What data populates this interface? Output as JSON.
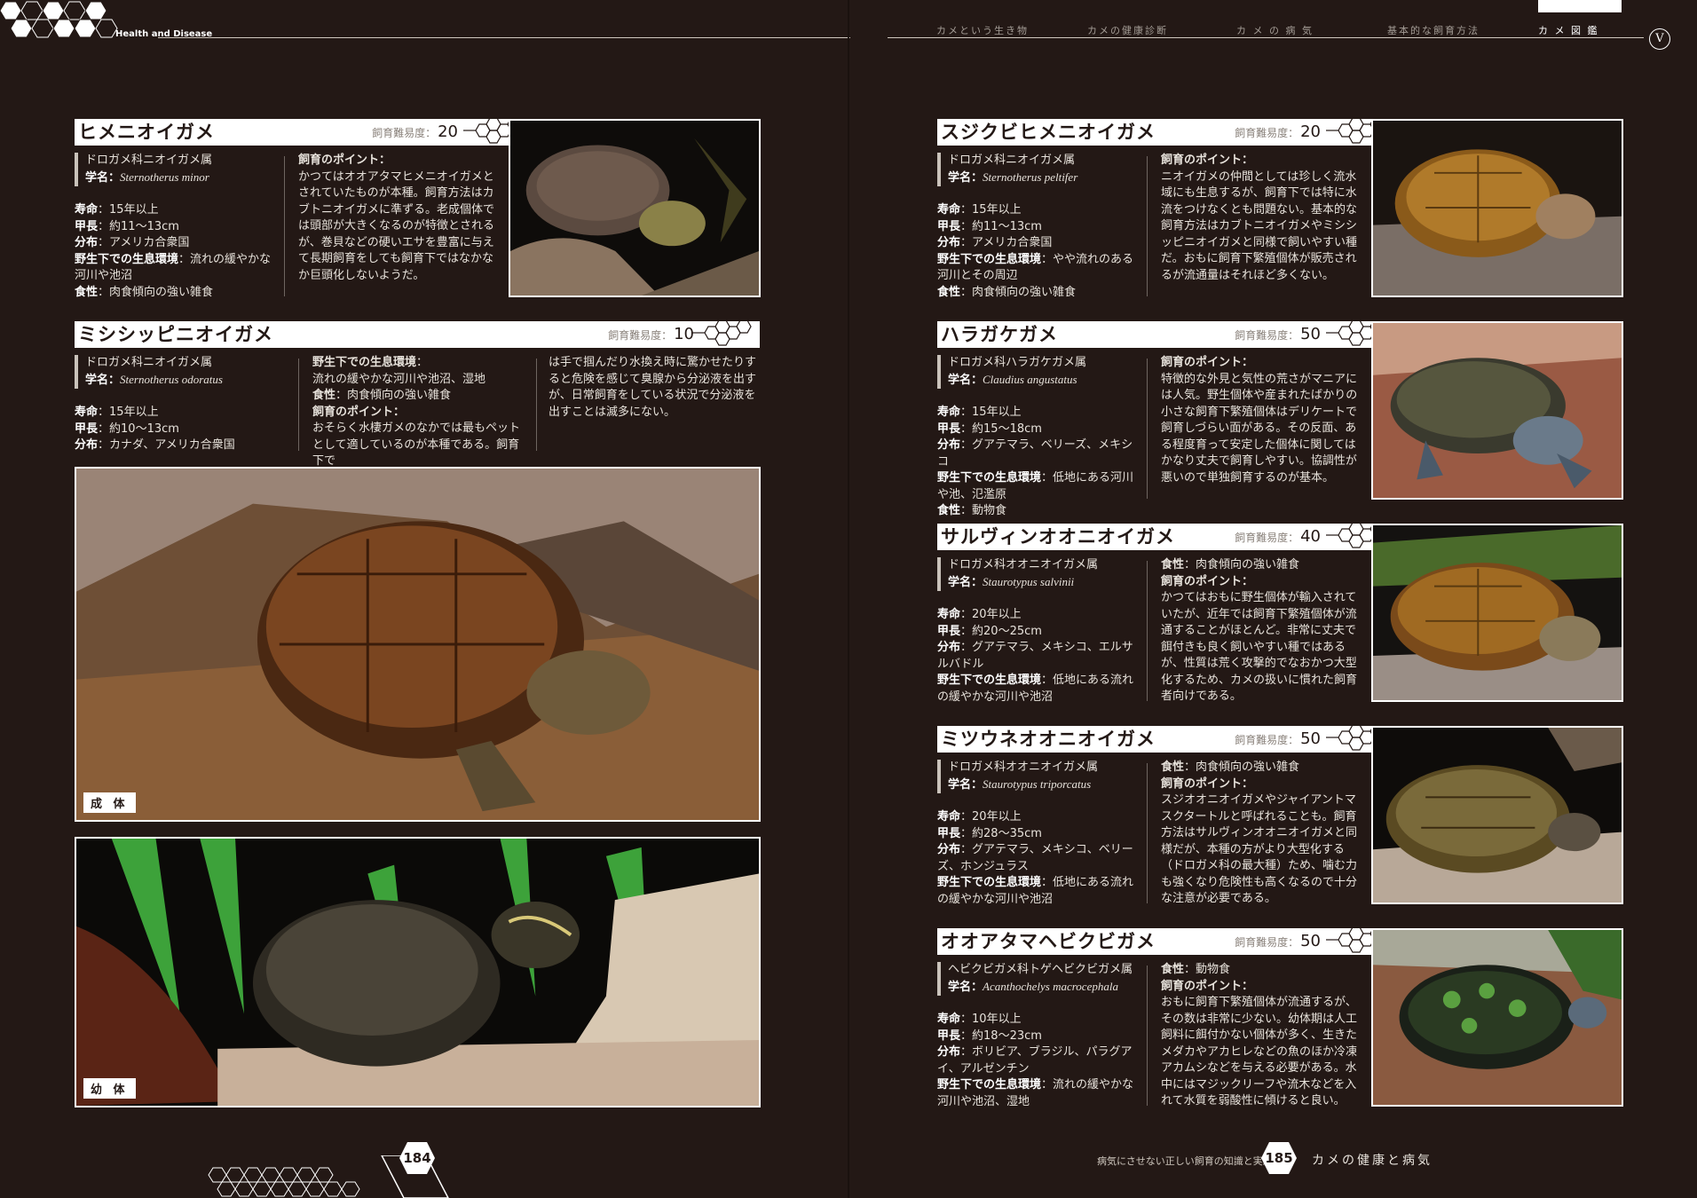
{
  "header": {
    "section_label": "Health and Disease",
    "nav": [
      "カメという生き物",
      "カメの健康診断",
      "カ メ の 病 気",
      "基本的な飼育方法",
      "カ メ 図 鑑"
    ],
    "chapter_badge": "V"
  },
  "difficulty_label": "飼育難易度：",
  "photo_tags": {
    "adult": "成 体",
    "juvenile": "幼 体"
  },
  "species": [
    {
      "name": "ヒメニオイガメ",
      "difficulty": "20",
      "family": "ドロガメ科ニオイガメ属",
      "sci_label": "学名：",
      "sci": "Sternotherus minor",
      "lifespan_label": "寿命",
      "lifespan": "15年以上",
      "length_label": "甲長",
      "length": "約11～13cm",
      "range_label": "分布",
      "range": "アメリカ合衆国",
      "habitat_label": "野生下での生息環境",
      "habitat": "流れの緩やかな河川や池沼",
      "diet_label": "食性",
      "diet": "肉食傾向の強い雑食",
      "point_label": "飼育のポイント：",
      "point": "かつてはオオアタマヒメニオイガメとされていたものが本種。飼育方法はカブトニオイガメに準ずる。老成個体では頭部が大きくなるのが特徴とされるが、巻貝などの硬いエサを豊富に与えて長期飼育をしても飼育下ではなかなか巨頭化しないようだ。"
    },
    {
      "name": "ミシシッピニオイガメ",
      "difficulty": "10",
      "family": "ドロガメ科ニオイガメ属",
      "sci_label": "学名：",
      "sci": "Sternotherus odoratus",
      "lifespan_label": "寿命",
      "lifespan": "15年以上",
      "length_label": "甲長",
      "length": "約10～13cm",
      "range_label": "分布",
      "range": "カナダ、アメリカ合衆国",
      "habitat_label": "野生下での生息環境",
      "habitat": "流れの緩やかな河川や池沼、湿地",
      "diet_label": "食性",
      "diet": "肉食傾向の強い雑食",
      "point_label": "飼育のポイント：",
      "point": "おそらく水棲ガメのなかでは最もペットとして適しているのが本種である。飼育下で",
      "point_cont": "は手で掴んだり水換え時に驚かせたりすると危険を感じて臭腺から分泌液を出すが、日常飼育をしている状況で分泌液を出すことは滅多にない。"
    },
    {
      "name": "スジクビヒメニオイガメ",
      "difficulty": "20",
      "family": "ドロガメ科ニオイガメ属",
      "sci_label": "学名：",
      "sci": "Sternotherus peltifer",
      "lifespan_label": "寿命",
      "lifespan": "15年以上",
      "length_label": "甲長",
      "length": "約11～13cm",
      "range_label": "分布",
      "range": "アメリカ合衆国",
      "habitat_label": "野生下での生息環境",
      "habitat": "やや流れのある河川とその周辺",
      "diet_label": "食性",
      "diet": "肉食傾向の強い雑食",
      "point_label": "飼育のポイント：",
      "point": "ニオイガメの仲間としては珍しく流水域にも生息するが、飼育下では特に水流をつけなくとも問題ない。基本的な飼育方法はカブトニオイガメやミシシッピニオイガメと同様で飼いやすい種だ。おもに飼育下繁殖個体が販売されるが流通量はそれほど多くない。"
    },
    {
      "name": "ハラガケガメ",
      "difficulty": "50",
      "family": "ドロガメ科ハラガケガメ属",
      "sci_label": "学名：",
      "sci": "Claudius angustatus",
      "lifespan_label": "寿命",
      "lifespan": "15年以上",
      "length_label": "甲長",
      "length": "約15～18cm",
      "range_label": "分布",
      "range": "グアテマラ、ベリーズ、メキシコ",
      "habitat_label": "野生下での生息環境",
      "habitat": "低地にある河川や池、氾濫原",
      "diet_label": "食性",
      "diet": "動物食",
      "point_label": "飼育のポイント：",
      "point": "特徴的な外見と気性の荒さがマニアには人気。野生個体や産まれたばかりの小さな飼育下繁殖個体はデリケートで飼育しづらい面がある。その反面、ある程度育って安定した個体に関してはかなり丈夫で飼育しやすい。協調性が悪いので単独飼育するのが基本。"
    },
    {
      "name": "サルヴィンオオニオイガメ",
      "difficulty": "40",
      "family": "ドロガメ科オオニオイガメ属",
      "sci_label": "学名：",
      "sci": "Staurotypus salvinii",
      "lifespan_label": "寿命",
      "lifespan": "20年以上",
      "length_label": "甲長",
      "length": "約20～25cm",
      "range_label": "分布",
      "range": "グアテマラ、メキシコ、エルサルバドル",
      "habitat_label": "野生下での生息環境",
      "habitat": "低地にある流れの緩やかな河川や池沼",
      "diet_label": "食性",
      "diet": "肉食傾向の強い雑食",
      "point_label": "飼育のポイント：",
      "point": "かつてはおもに野生個体が輸入されていたが、近年では飼育下繁殖個体が流通することがほとんど。非常に丈夫で餌付きも良く飼いやすい種ではあるが、性質は荒く攻撃的でなおかつ大型化するため、カメの扱いに慣れた飼育者向けである。"
    },
    {
      "name": "ミツウネオオニオイガメ",
      "difficulty": "50",
      "family": "ドロガメ科オオニオイガメ属",
      "sci_label": "学名：",
      "sci": "Staurotypus triporcatus",
      "lifespan_label": "寿命",
      "lifespan": "20年以上",
      "length_label": "甲長",
      "length": "約28～35cm",
      "range_label": "分布",
      "range": "グアテマラ、メキシコ、ベリーズ、ホンジュラス",
      "habitat_label": "野生下での生息環境",
      "habitat": "低地にある流れの緩やかな河川や池沼",
      "diet_label": "食性",
      "diet": "肉食傾向の強い雑食",
      "point_label": "飼育のポイント：",
      "point": "スジオオニオイガメやジャイアントマスクタートルと呼ばれることも。飼育方法はサルヴィンオオニオイガメと同様だが、本種の方がより大型化する（ドロガメ科の最大種）ため、噛む力も強くなり危険性も高くなるので十分な注意が必要である。"
    },
    {
      "name": "オオアタマヘビクビガメ",
      "difficulty": "50",
      "family": "ヘビクビガメ科トゲヘビクビガメ属",
      "sci_label": "学名：",
      "sci": "Acanthochelys macrocephala",
      "lifespan_label": "寿命",
      "lifespan": "10年以上",
      "length_label": "甲長",
      "length": "約18～23cm",
      "range_label": "分布",
      "range": "ボリビア、ブラジル、パラグアイ、アルゼンチン",
      "habitat_label": "野生下での生息環境",
      "habitat": "流れの緩やかな河川や池沼、湿地",
      "diet_label": "食性",
      "diet": "動物食",
      "point_label": "飼育のポイント：",
      "point": "おもに飼育下繁殖個体が流通するが、その数は非常に少ない。幼体期は人工飼料に餌付かない個体が多く、生きたメダカやアカヒレなどの魚のほか冷凍アカムシなどを与える必要がある。水中にはマジックリーフや流木などを入れて水質を弱酸性に傾けると良い。"
    }
  ],
  "footer": {
    "left_page": "184",
    "right_page": "185",
    "book_title": "病気にさせない正しい飼育の知識と実践",
    "section_title": "カメの健康と病気"
  }
}
